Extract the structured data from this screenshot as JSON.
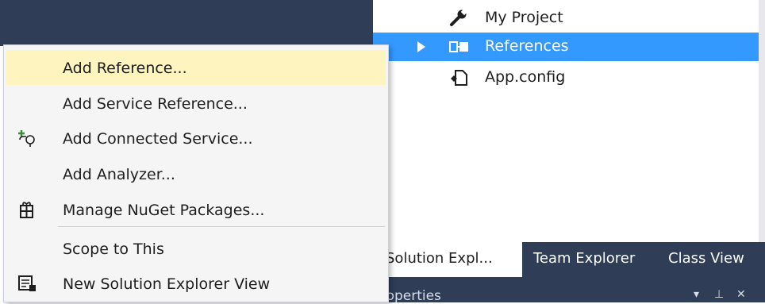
{
  "solution_explorer": {
    "tree": [
      {
        "label": "My Project",
        "icon": "wrench-icon",
        "selected": false
      },
      {
        "label": "References",
        "icon": "references-icon",
        "selected": true
      },
      {
        "label": "App.config",
        "icon": "config-file-icon",
        "selected": false
      }
    ]
  },
  "tabs": {
    "solution": "Solution Expl...",
    "team": "Team Explorer",
    "classview": "Class View"
  },
  "properties": {
    "title": "Properties",
    "dropdown": "▾",
    "pin": "⊥",
    "close": "✕"
  },
  "context_menu": {
    "items": [
      {
        "label": "Add Reference...",
        "icon": null,
        "highlighted": true
      },
      {
        "label": "Add Service Reference...",
        "icon": null,
        "highlighted": false
      },
      {
        "label": "Add Connected Service...",
        "icon": "connected-service-icon",
        "highlighted": false
      },
      {
        "label": "Add Analyzer...",
        "icon": null,
        "highlighted": false
      },
      {
        "label": "Manage NuGet Packages...",
        "icon": "nuget-package-icon",
        "highlighted": false
      },
      {
        "label": "Scope to This",
        "icon": null,
        "highlighted": false
      },
      {
        "label": "New Solution Explorer View",
        "icon": "new-explorer-view-icon",
        "highlighted": false
      }
    ]
  },
  "colors": {
    "chrome_dark": "#2f3d57",
    "selection_blue": "#3399ff",
    "menu_highlight": "#fdf4bf",
    "menu_bg": "#f5f5f5"
  }
}
